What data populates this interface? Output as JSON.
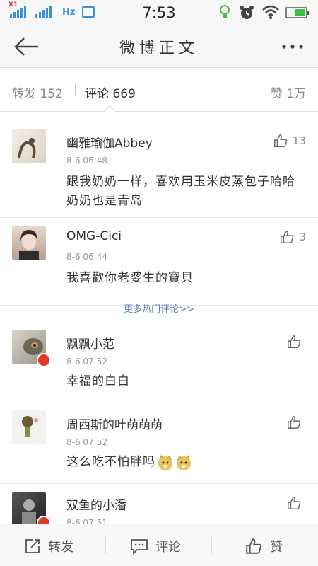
{
  "status_bar": {
    "time": "7:53",
    "carrier_badge": "X1",
    "network_label": "Hz"
  },
  "nav": {
    "title": "微博正文",
    "back_icon": "arrow-left-icon",
    "more_icon": "more-dots-icon"
  },
  "tabs": {
    "repost": "转发 152",
    "comment": "评论 669",
    "like": "赞 1万"
  },
  "comments": [
    {
      "name": "幽雅瑜伽Abbey",
      "time": "8-6 06:48",
      "text": "跟我奶奶一样，喜欢用玉米皮蒸包子哈哈奶奶也是青岛",
      "likes": "13"
    },
    {
      "name": "OMG-Cici",
      "time": "8-6 06:44",
      "text": "我喜歡你老婆生的寶貝",
      "likes": "3"
    },
    {
      "name": "飘飘小范",
      "time": "8-6 07:52",
      "text": "幸福的白白",
      "likes": ""
    },
    {
      "name": "周西斯的叶萌萌萌",
      "time": "8-6 07:52",
      "text": "这么吃不怕胖吗",
      "likes": ""
    },
    {
      "name": "双鱼的小潘",
      "time": "8-6 07:51",
      "text": "",
      "likes": ""
    }
  ],
  "more_hot": "更多热门评论>>",
  "bottom_bar": {
    "repost": "转发",
    "comment": "评论",
    "like": "赞"
  },
  "colors": {
    "link": "#5b82b9",
    "badge": "#e3372b",
    "signal": "#3a92d6",
    "battery": "#3fbf3f"
  }
}
